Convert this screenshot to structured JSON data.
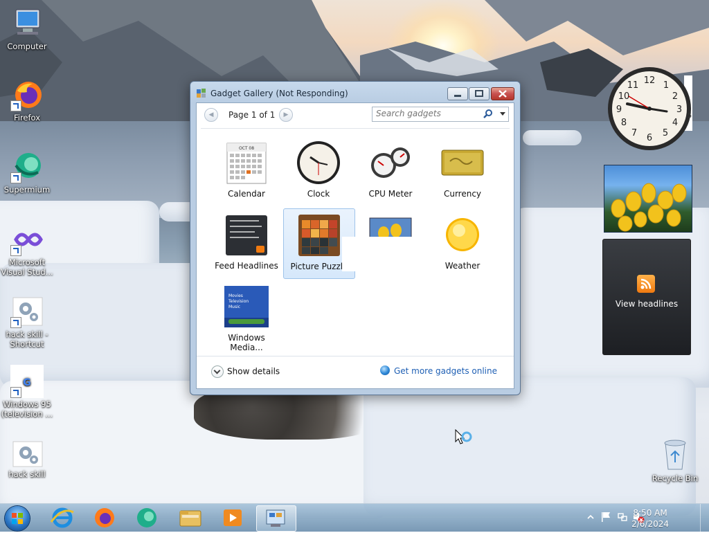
{
  "desktop": {
    "icons": [
      {
        "label": "Computer"
      },
      {
        "label": "Firefox"
      },
      {
        "label": "Supermium"
      },
      {
        "label": "Microsoft Visual Stud..."
      },
      {
        "label": "hack skill - Shortcut"
      },
      {
        "label": "Windows 95 (television ..."
      },
      {
        "label": "hack skill"
      },
      {
        "label": "Recycle Bin"
      }
    ]
  },
  "window": {
    "title": "Gadget Gallery (Not Responding)",
    "page_label": "Page 1 of 1",
    "search_placeholder": "Search gadgets",
    "gadgets": [
      {
        "label": "Calendar",
        "icon": "calendar-icon"
      },
      {
        "label": "Clock",
        "icon": "clock-icon"
      },
      {
        "label": "CPU Meter",
        "icon": "cpu-meter-icon"
      },
      {
        "label": "Currency",
        "icon": "currency-icon"
      },
      {
        "label": "Feed Headlines",
        "icon": "feed-headlines-icon"
      },
      {
        "label": "Picture Puzzle",
        "icon": "picture-puzzle-icon"
      },
      {
        "label": "",
        "icon": "slide-show-icon"
      },
      {
        "label": "Weather",
        "icon": "weather-icon"
      },
      {
        "label": "Windows Media...",
        "icon": "windows-media-center-icon"
      }
    ],
    "show_details": "Show details",
    "get_more": "Get more gadgets online",
    "calendar_month": "OCT 08",
    "media_menu": [
      "Movies",
      "Television",
      "Music"
    ]
  },
  "sidebar": {
    "feed_text": "View headlines",
    "clock_partial": "5"
  },
  "taskbar": {
    "time": "8:50 AM",
    "date": "2/6/2024"
  },
  "colors": {
    "accent": "#1e5fb4",
    "titlebar": "#c7d9ec",
    "close_button": "#c75050"
  }
}
